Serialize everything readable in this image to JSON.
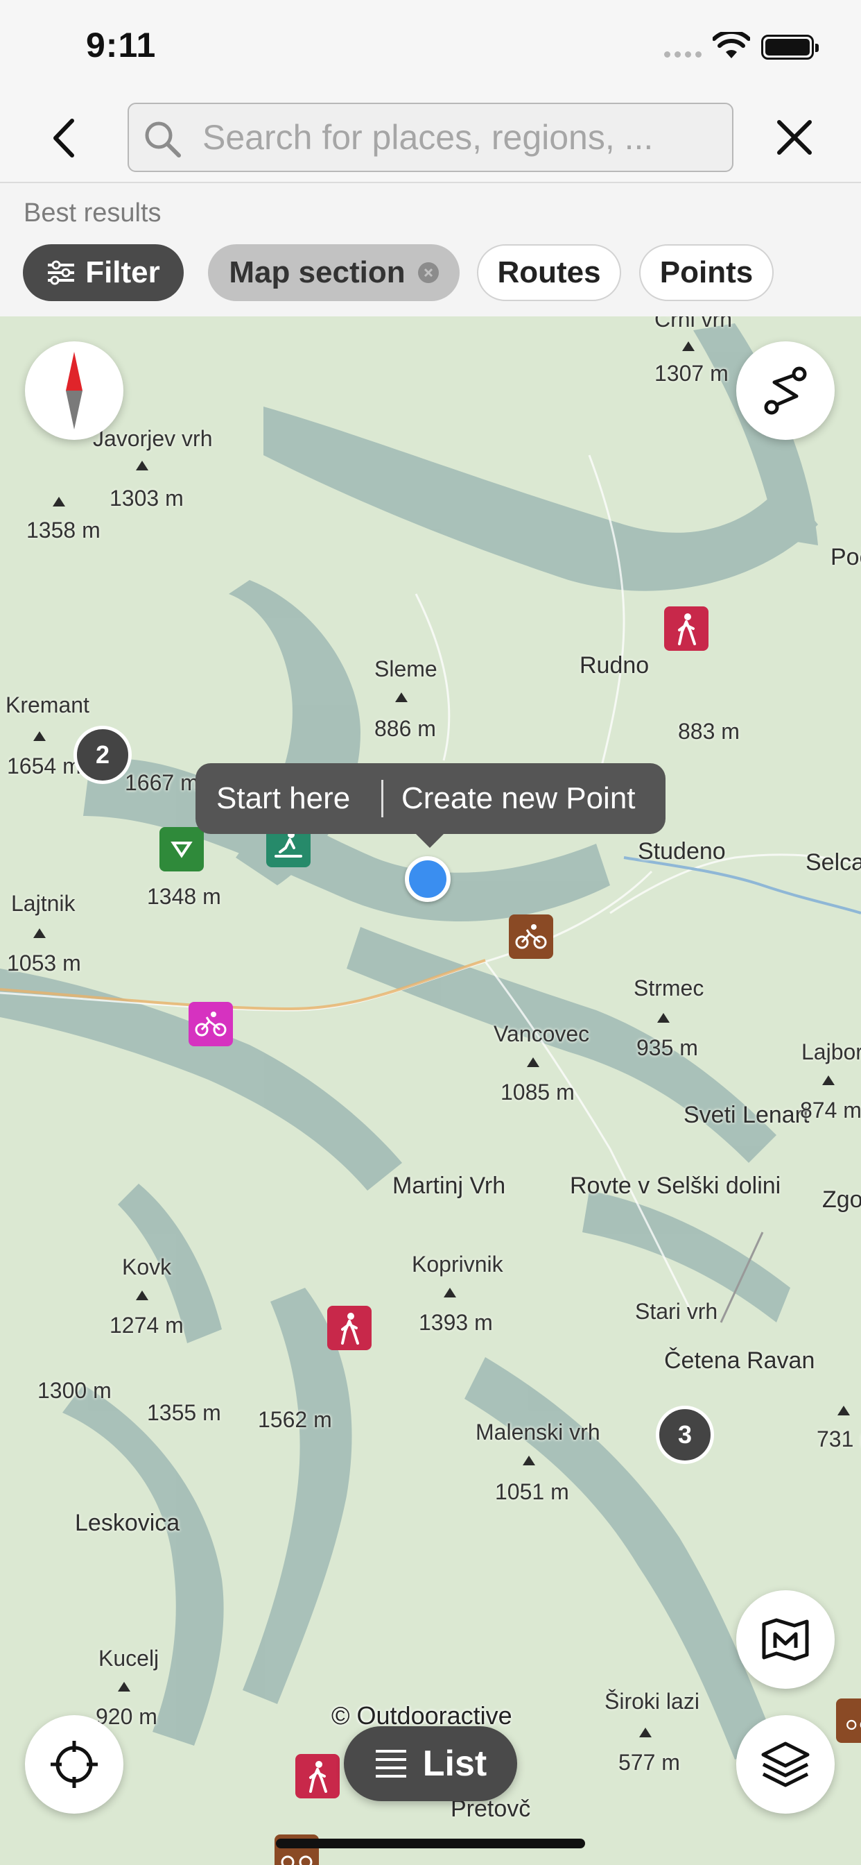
{
  "status_bar": {
    "time": "9:11"
  },
  "search": {
    "placeholder": "Search for places, regions, ..."
  },
  "results": {
    "heading": "Best results"
  },
  "chips": {
    "filter": "Filter",
    "map_section": "Map section",
    "routes": "Routes",
    "points": "Points"
  },
  "popup": {
    "start_here": "Start here",
    "create_point": "Create new Point"
  },
  "map_labels": {
    "chrivrh": "Črni vrh",
    "e1307": "1307 m",
    "javorjev": "Javorjev vrh",
    "e1303": "1303 m",
    "e1358": "1358 m",
    "poc": "Poč",
    "sleme": "Sleme",
    "e886": "886 m",
    "rudno": "Rudno",
    "e883": "883 m",
    "kremant": "Kremant",
    "e1654": "1654 m",
    "e1667": "1667 m",
    "studeno": "Studeno",
    "selca": "Selca",
    "lajtnik": "Lajtnik",
    "e1053": "1053 m",
    "e1348": "1348 m",
    "strmec": "Strmec",
    "e935": "935 m",
    "vancovec": "Vancovec",
    "e1085": "1085 m",
    "lajbor": "Lajbor",
    "sveti_lenart": "Sveti Lenart",
    "e874": "874 m",
    "martinj": "Martinj Vrh",
    "rovte": "Rovte v Selški dolini",
    "zgo": "Zgo",
    "kovk": "Kovk",
    "e1274": "1274 m",
    "koprivnik": "Koprivnik",
    "e1393": "1393 m",
    "stari_vrh": "Stari vrh",
    "cetena": "Četena Ravan",
    "e1300": "1300 m",
    "e1355": "1355 m",
    "e1562": "1562 m",
    "malenski": "Malenski vrh",
    "e731": "731 m",
    "e1051": "1051 m",
    "leskovica": "Leskovica",
    "kucelj": "Kucelj",
    "e920": "920 m",
    "siroki": "Široki lazi",
    "e577": "577 m",
    "pretovc": "Pretovč"
  },
  "clusters": {
    "c1": "2",
    "c2": "3"
  },
  "copyright": "© Outdooractive",
  "list_button": "List",
  "colors": {
    "accent_blue": "#3a8ef0",
    "hike_poi": "#c8284a",
    "bike_poi": "#8a4a25"
  }
}
